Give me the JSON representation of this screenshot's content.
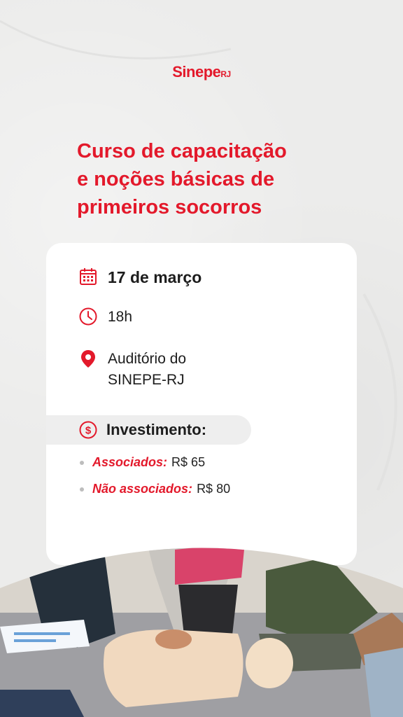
{
  "brand": {
    "logo_main": "Sinepe",
    "logo_suffix": "RJ"
  },
  "title_lines": [
    "Curso de capacitação",
    "e noções básicas de",
    "primeiros socorros"
  ],
  "event": {
    "date": "17 de março",
    "time": "18h",
    "location_line1": "Auditório do",
    "location_line2": "SINEPE-RJ"
  },
  "investment": {
    "heading": "Investimento:",
    "items": [
      {
        "label": "Associados:",
        "value": "R$ 65"
      },
      {
        "label": "Não associados:",
        "value": "R$ 80"
      }
    ]
  },
  "icons": [
    "calendar-icon",
    "clock-icon",
    "location-pin-icon",
    "dollar-circle-icon"
  ],
  "colors": {
    "accent": "#e3192b",
    "background": "#ececeb",
    "card": "#ffffff",
    "text": "#1d1d1d"
  }
}
